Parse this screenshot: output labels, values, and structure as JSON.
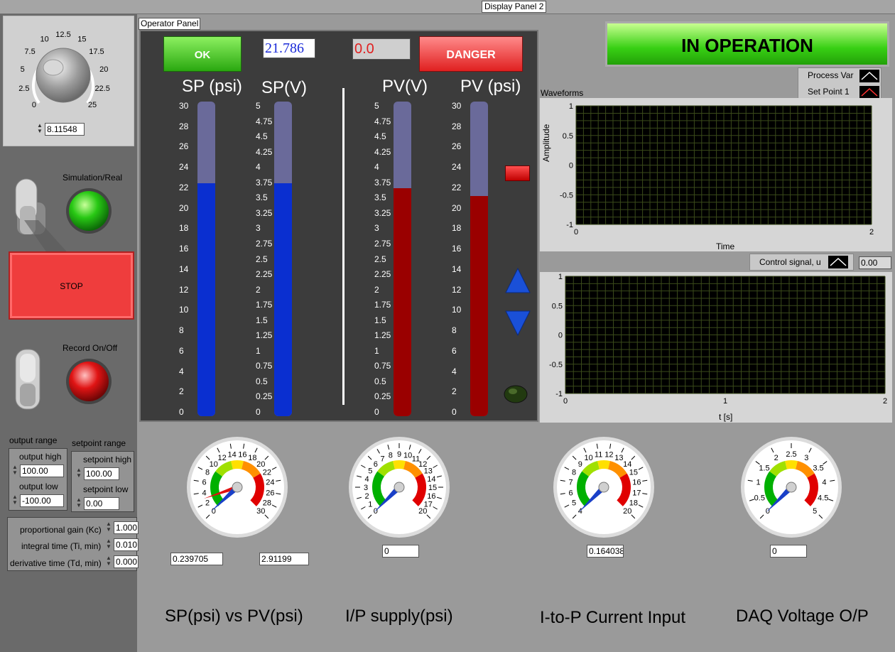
{
  "window": {
    "title": "Display Panel 2"
  },
  "knob": {
    "ticks": [
      "0",
      "2.5",
      "5",
      "7.5",
      "10",
      "12.5",
      "15",
      "17.5",
      "20",
      "22.5",
      "25"
    ],
    "value": "8.11548"
  },
  "switches": {
    "sim_label": "Simulation/Real",
    "stop_label": "STOP",
    "record_label": "Record On/Off"
  },
  "ranges": {
    "output_title": "output range",
    "output_high_label": "output high",
    "output_high": "100.00",
    "output_low_label": "output low",
    "output_low": "-100.00",
    "setpoint_title": "setpoint range",
    "setpoint_high_label": "setpoint high",
    "setpoint_high": "100.00",
    "setpoint_low_label": "setpoint low",
    "setpoint_low": "0.00"
  },
  "pid": {
    "kc_label": "proportional gain (Kc)",
    "kc": "1.000",
    "ti_label": "integral time (Ti, min)",
    "ti": "0.010",
    "td_label": "derivative time (Td, min)",
    "td": "0.000"
  },
  "operator": {
    "title": "Operator Panel",
    "ok_label": "OK",
    "danger_label": "DANGER",
    "display1": "21.786",
    "display2": "0.0",
    "sp_psi_title": "SP (psi)",
    "sp_v_title": "SP(V)",
    "pv_v_title": "PV(V)",
    "pv_psi_title": "PV (psi)",
    "psi_ticks": [
      "30",
      "28",
      "26",
      "24",
      "22",
      "20",
      "18",
      "16",
      "14",
      "12",
      "10",
      "8",
      "6",
      "4",
      "2",
      "0"
    ],
    "volt_ticks": [
      "5",
      "4.75",
      "4.5",
      "4.25",
      "4",
      "3.75",
      "3.5",
      "3.25",
      "3",
      "2.75",
      "2.5",
      "2.25",
      "2",
      "1.75",
      "1.5",
      "1.25",
      "1",
      "0.75",
      "0.5",
      "0.25",
      "0"
    ],
    "sp_psi_level": 0.74,
    "sp_v_level": 0.74,
    "pv_v_level": 0.725,
    "pv_psi_level": 0.7
  },
  "status": {
    "in_operation": "IN OPERATION"
  },
  "waveform": {
    "title": "Waveforms",
    "legend": [
      "Process Var",
      "Set Point 1"
    ],
    "y_ticks": [
      "1",
      "0.5",
      "0",
      "-0.5",
      "-1"
    ],
    "x_ticks": [
      "0",
      "2"
    ],
    "xlabel": "Time",
    "ylabel": "Amplitude"
  },
  "control": {
    "legend": "Control signal, u",
    "value": "0.00",
    "y_ticks": [
      "1",
      "0.5",
      "0",
      "-0.5",
      "-1"
    ],
    "x_ticks": [
      "0",
      "1",
      "2"
    ],
    "xlabel": "t [s]"
  },
  "gauges": {
    "g1": {
      "ticks": [
        "0",
        "2",
        "4",
        "6",
        "8",
        "10",
        "12",
        "14",
        "16",
        "18",
        "20",
        "22",
        "24",
        "26",
        "28",
        "30"
      ],
      "value_a": "0.239705",
      "value_b": "2.91199",
      "label": "SP(psi) vs PV(psi)"
    },
    "g2": {
      "ticks": [
        "0",
        "1",
        "2",
        "3",
        "4",
        "5",
        "6",
        "7",
        "8",
        "9",
        "10",
        "11",
        "12",
        "13",
        "14",
        "15",
        "16",
        "17",
        "20"
      ],
      "value": "0",
      "label": "I/P supply(psi)"
    },
    "g3": {
      "ticks": [
        "4",
        "5",
        "6",
        "7",
        "8",
        "9",
        "10",
        "11",
        "12",
        "13",
        "14",
        "15",
        "16",
        "17",
        "18",
        "20"
      ],
      "value": "0.164038",
      "label": "I-to-P Current Input"
    },
    "g4": {
      "ticks": [
        "0",
        "0.5",
        "1",
        "1.5",
        "2",
        "2.5",
        "3",
        "3.5",
        "4",
        "4.5",
        "5"
      ],
      "value": "0",
      "label": "DAQ Voltage O/P"
    }
  },
  "colors": {
    "sp_fill": "#0a2fd0",
    "pv_fill": "#9a0000",
    "tank_empty": "#6a6a9a",
    "ok_green": "#39c21a",
    "danger_red": "#e83a3a"
  }
}
